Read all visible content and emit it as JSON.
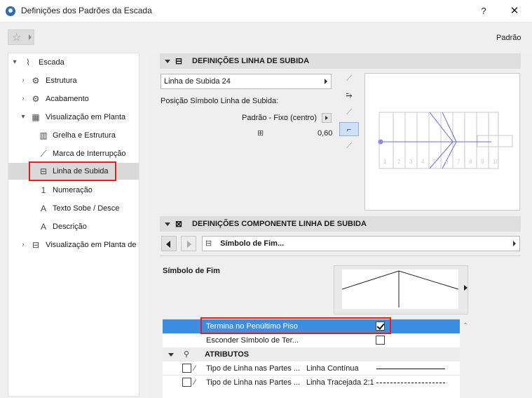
{
  "window": {
    "title": "Definições dos Padrões da Escada",
    "help_label": "?",
    "close_label": "✕"
  },
  "favorites": {
    "star_icon": "star-icon"
  },
  "preset_label": "Padrão",
  "tree": {
    "items": [
      {
        "label": "Escada",
        "icon": "stair-icon",
        "expand": "▾"
      },
      {
        "label": "Estrutura",
        "icon": "structure-icon",
        "expand": "›"
      },
      {
        "label": "Acabamento",
        "icon": "finish-icon",
        "expand": "›"
      },
      {
        "label": "Visualização em Planta",
        "icon": "floorplan-icon",
        "expand": "▾"
      },
      {
        "label": "Grelha e Estrutura",
        "icon": "grid-icon"
      },
      {
        "label": "Marca de Interrupção",
        "icon": "break-mark-icon"
      },
      {
        "label": "Linha de Subida",
        "icon": "walkline-icon",
        "selected": true
      },
      {
        "label": "Numeração",
        "icon": "numbering-icon"
      },
      {
        "label": "Texto Sobe / Desce",
        "icon": "up-down-text-icon"
      },
      {
        "label": "Descrição",
        "icon": "description-icon"
      },
      {
        "label": "Visualização em Planta de",
        "icon": "floorplan-icon-2",
        "expand": "›"
      }
    ]
  },
  "walkline": {
    "header": "DEFINIÇÕES LINHA DE SUBIDA",
    "type_dropdown": "Linha de Subida 24",
    "position_label": "Posição Símbolo Linha de Subida:",
    "position_dropdown": "Padrão - Fixo (centro)",
    "offset_value": "0,60"
  },
  "preview_numbers": [
    "1",
    "2",
    "3",
    "4",
    "5",
    "6",
    "7",
    "8",
    "9",
    "10"
  ],
  "component": {
    "header": "DEFINIÇÕES COMPONENTE LINHA DE SUBIDA",
    "dropdown": "Símbolo de Fim...",
    "symbol_label": "Símbolo de Fim"
  },
  "table": {
    "rows": [
      {
        "label": "Termina no Penúltimo Piso",
        "checked": true
      },
      {
        "label": "Esconder Símbolo de Ter...",
        "checked": false
      }
    ],
    "group": "ATRIBUTOS",
    "attr_rows": [
      {
        "label": "Tipo de Linha nas Partes ...",
        "value": "Linha Contínua"
      },
      {
        "label": "Tipo de Linha nas Partes ...",
        "value": "Linha Tracejada 2:1"
      }
    ]
  }
}
